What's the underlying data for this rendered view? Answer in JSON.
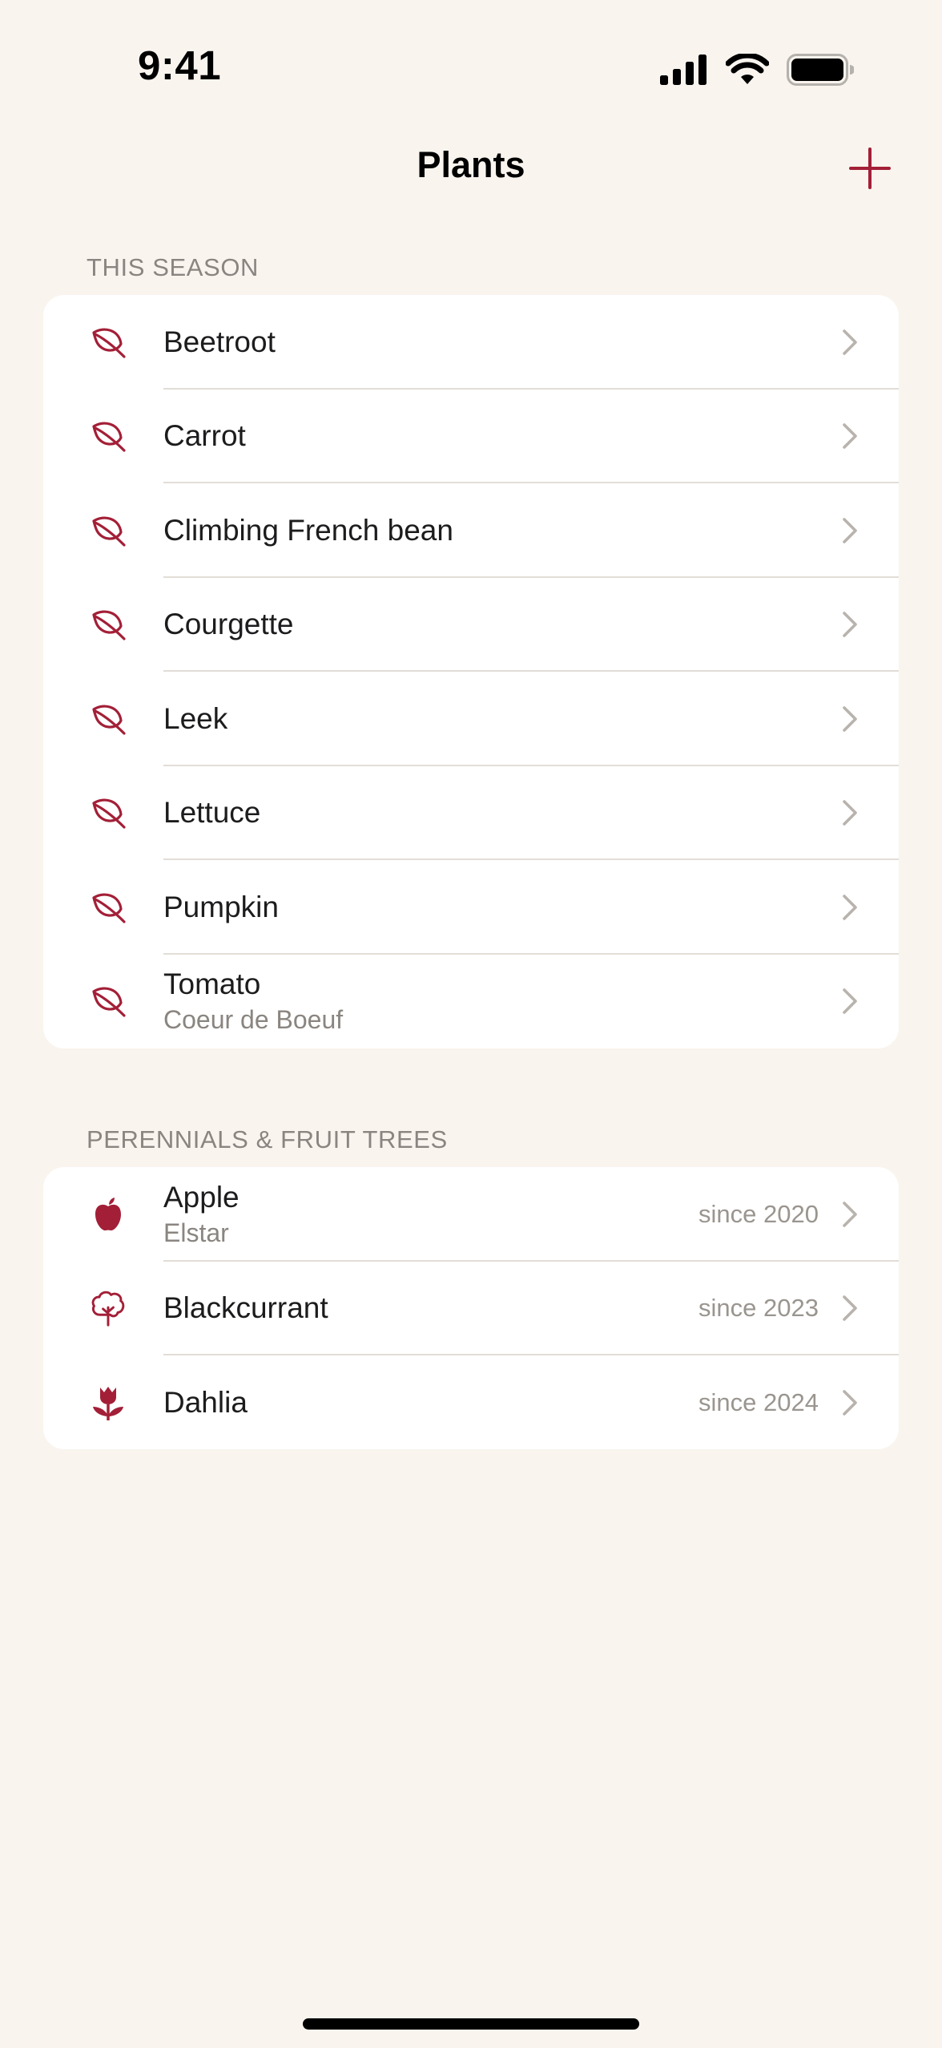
{
  "status_bar": {
    "time": "9:41"
  },
  "nav": {
    "title": "Plants",
    "add_icon": "plus-icon"
  },
  "colors": {
    "accent": "#a31f37",
    "background": "#f9f4ee",
    "card": "#ffffff",
    "secondary_text": "#8a8580"
  },
  "this_season": {
    "header": "THIS SEASON",
    "items": [
      {
        "title": "Beetroot",
        "subtitle": "",
        "detail": "",
        "icon": "leaf-icon"
      },
      {
        "title": "Carrot",
        "subtitle": "",
        "detail": "",
        "icon": "leaf-icon"
      },
      {
        "title": "Climbing French bean",
        "subtitle": "",
        "detail": "",
        "icon": "leaf-icon"
      },
      {
        "title": "Courgette",
        "subtitle": "",
        "detail": "",
        "icon": "leaf-icon"
      },
      {
        "title": "Leek",
        "subtitle": "",
        "detail": "",
        "icon": "leaf-icon"
      },
      {
        "title": "Lettuce",
        "subtitle": "",
        "detail": "",
        "icon": "leaf-icon"
      },
      {
        "title": "Pumpkin",
        "subtitle": "",
        "detail": "",
        "icon": "leaf-icon"
      },
      {
        "title": "Tomato",
        "subtitle": "Coeur de Boeuf",
        "detail": "",
        "icon": "leaf-icon"
      }
    ]
  },
  "perennials": {
    "header": "PERENNIALS & FRUIT TREES",
    "items": [
      {
        "title": "Apple",
        "subtitle": "Elstar",
        "detail": "since 2020",
        "icon": "apple-icon"
      },
      {
        "title": "Blackcurrant",
        "subtitle": "",
        "detail": "since 2023",
        "icon": "tree-icon"
      },
      {
        "title": "Dahlia",
        "subtitle": "",
        "detail": "since 2024",
        "icon": "tulip-icon"
      }
    ]
  }
}
